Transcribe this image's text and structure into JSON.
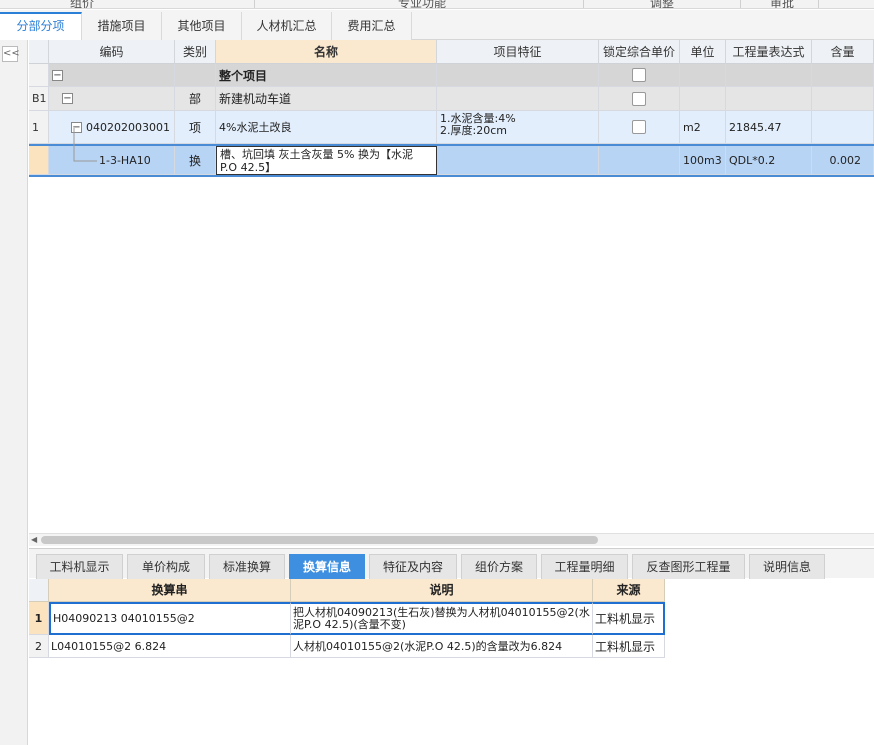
{
  "ribbon": {
    "items": [
      "组价",
      "专业功能",
      "调整",
      "审批"
    ]
  },
  "main_tabs": [
    {
      "label": "分部分项",
      "active": true
    },
    {
      "label": "措施项目",
      "active": false
    },
    {
      "label": "其他项目",
      "active": false
    },
    {
      "label": "人材机汇总",
      "active": false
    },
    {
      "label": "费用汇总",
      "active": false
    }
  ],
  "collapse_glyph": "<<",
  "grid": {
    "headers": [
      "编码",
      "类别",
      "名称",
      "项目特征",
      "锁定综合单价",
      "单位",
      "工程量表达式",
      "含量"
    ],
    "rows": [
      {
        "rownum": "",
        "code": "",
        "type": "",
        "name": "整个项目",
        "feature": "",
        "unit": "",
        "expr": "",
        "qty": "",
        "expander": "−"
      },
      {
        "rownum": "B1",
        "code": "",
        "type": "部",
        "name": "新建机动车道",
        "feature": "",
        "unit": "",
        "expr": "",
        "qty": "",
        "expander": "−"
      },
      {
        "rownum": "1",
        "code": "040202003001",
        "type": "项",
        "name": "4%水泥土改良",
        "feature_lines": [
          "1.水泥含量:4%",
          "2.厚度:20cm"
        ],
        "unit": "m2",
        "expr": "21845.47",
        "qty": "",
        "expander": "−"
      },
      {
        "rownum": "",
        "code": "1-3-HA10",
        "type": "换",
        "name_lines": [
          "槽、坑回填 灰土含灰量 5% 换为【水泥",
          "P.O 42.5】"
        ],
        "feature": "",
        "unit": "100m3",
        "expr": "QDL*0.2",
        "qty": "0.002"
      }
    ]
  },
  "bottom_tabs": [
    {
      "label": "工料机显示",
      "active": false
    },
    {
      "label": "单价构成",
      "active": false
    },
    {
      "label": "标准换算",
      "active": false
    },
    {
      "label": "换算信息",
      "active": true
    },
    {
      "label": "特征及内容",
      "active": false
    },
    {
      "label": "组价方案",
      "active": false
    },
    {
      "label": "工程量明细",
      "active": false
    },
    {
      "label": "反查图形工程量",
      "active": false
    },
    {
      "label": "说明信息",
      "active": false
    }
  ],
  "detail": {
    "headers": [
      "换算串",
      "说明",
      "来源"
    ],
    "rows": [
      {
        "rownum": "1",
        "string": "H04090213 04010155@2",
        "desc_lines": [
          "把人材机04090213(生石灰)替换为人材机04010155@2(水",
          "泥P.O 42.5)(含量不变)"
        ],
        "source": "工料机显示"
      },
      {
        "rownum": "2",
        "string": "L04010155@2 6.824",
        "desc_lines": [
          "人材机04010155@2(水泥P.O 42.5)的含量改为6.824"
        ],
        "source": "工料机显示"
      }
    ]
  }
}
